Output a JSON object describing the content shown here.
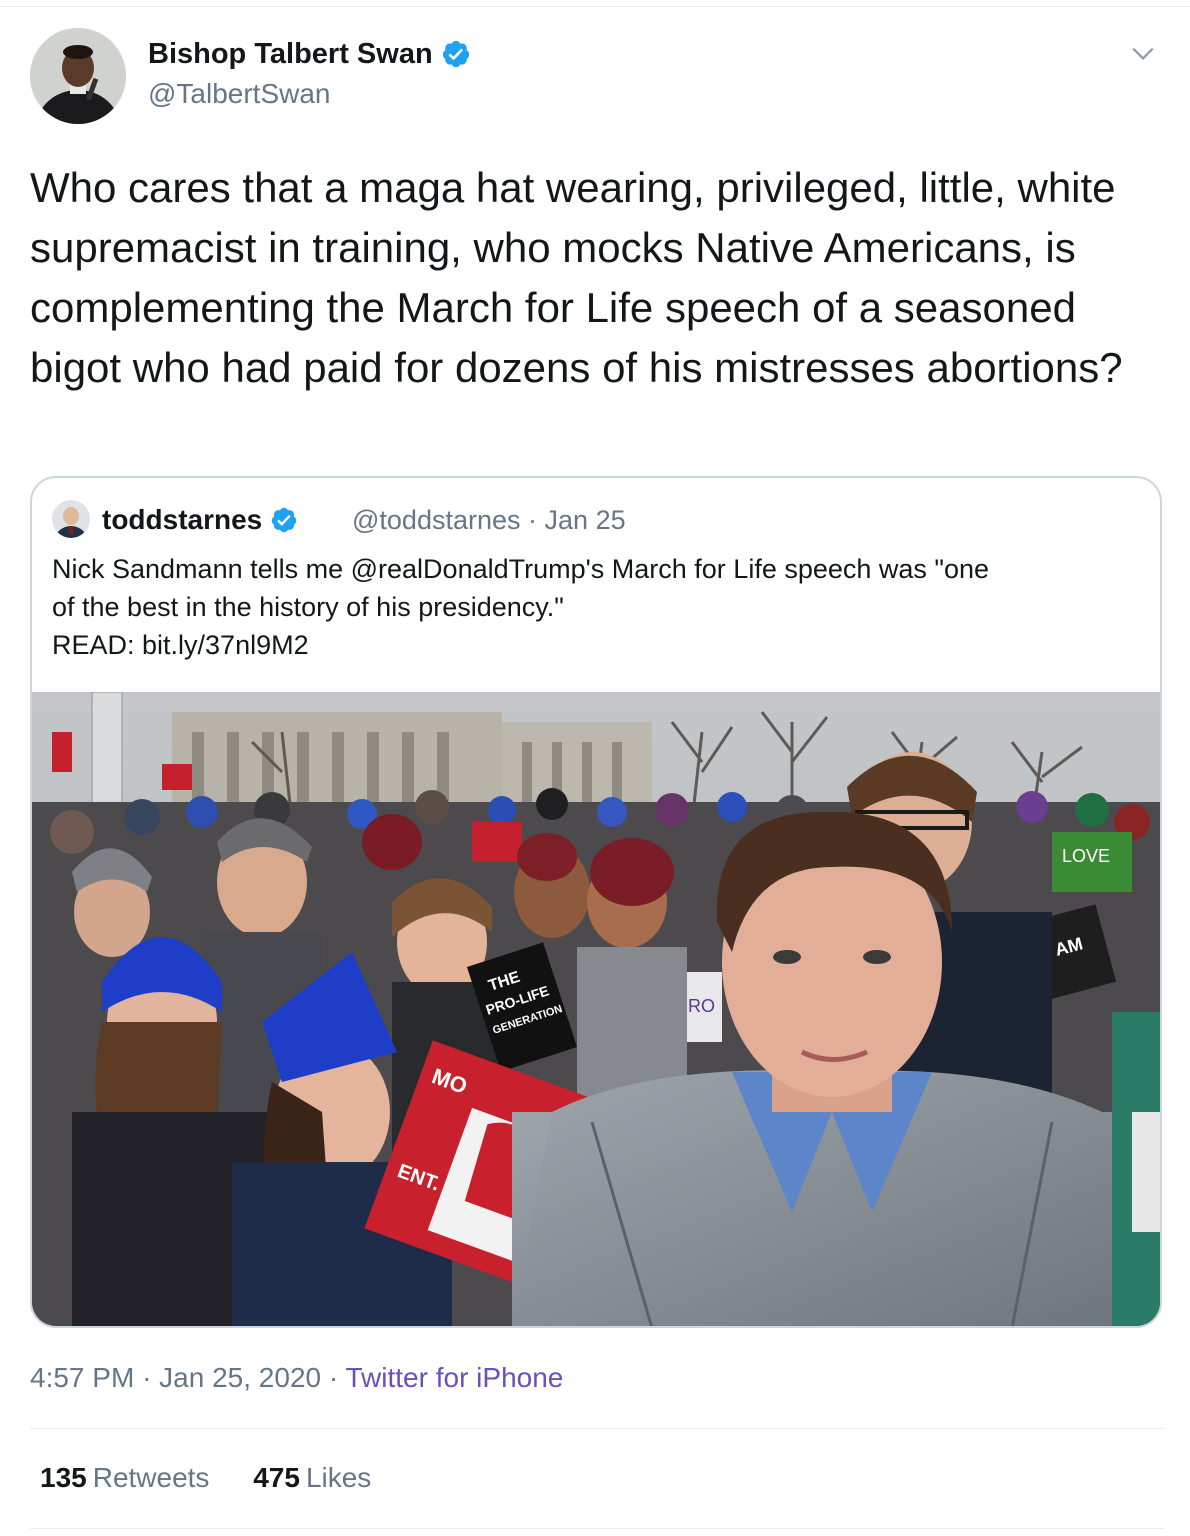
{
  "tweet": {
    "author": {
      "name": "Bishop Talbert Swan",
      "handle": "@TalbertSwan",
      "verified": true
    },
    "text": "Who cares that a maga hat wearing, privileged, little, white supremacist in training, who mocks Native Americans, is complementing the March for Life speech of a seasoned bigot who had paid for dozens of his mistresses abortions?",
    "quoted": {
      "name": "toddstarnes",
      "handle": "@toddstarnes",
      "date": "Jan 25",
      "separator": "·",
      "text_lines": [
        "Nick Sandmann tells me @realDonaldTrump's March for Life speech was \"one",
        "of the best in the history of his presidency.\"",
        "READ: bit.ly/37nl9M2"
      ],
      "image_signs": [
        "THE",
        "PRO-LIFE",
        "GENERATION",
        "LOVE",
        "I AM",
        "PRO",
        "MO",
        "ENT."
      ]
    },
    "time": "4:57 PM",
    "date": "Jan 25, 2020",
    "separator": "·",
    "source": "Twitter for iPhone",
    "stats": {
      "retweets": {
        "count": "135",
        "label": "Retweets"
      },
      "likes": {
        "count": "475",
        "label": "Likes"
      }
    }
  },
  "colors": {
    "verified": "#1da1f2",
    "secondary_text": "#657786",
    "source_link": "#6b4fbb",
    "border": "#ccd6dd"
  },
  "icons": [
    "verified-badge-icon",
    "chevron-down-icon"
  ]
}
